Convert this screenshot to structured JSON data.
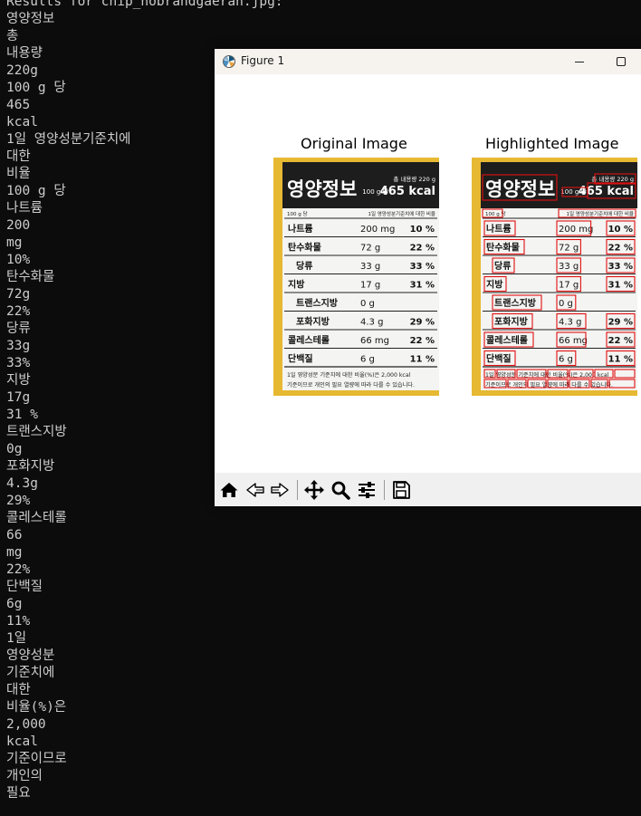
{
  "terminal": {
    "lines": [
      "Results for chip_nobrandgaeran.jpg:",
      "영양정보",
      "총",
      "내용량",
      "220g",
      "100 g 당",
      "465",
      "kcal",
      "1일 영양성분기준치에",
      "대한",
      "비율",
      "100 g 당",
      "나트륨",
      "200",
      "mg",
      "10%",
      "탄수화물",
      "72g",
      "22%",
      "당류",
      "33g",
      "33%",
      "지방",
      "17g",
      "31 %",
      "트랜스지방",
      "0g",
      "포화지방",
      "4.3g",
      "29%",
      "콜레스테롤",
      "66",
      "mg",
      "22%",
      "단백질",
      "6g",
      "11%",
      "1일",
      "영양성분",
      "기준치에",
      "대한",
      "비율(%)은",
      "2,000",
      "kcal",
      "기준이므로",
      "개인의",
      "필요"
    ]
  },
  "window": {
    "title": "Figure 1",
    "minimize_icon": "minimize-icon",
    "maximize_icon": "maximize-icon"
  },
  "figure": {
    "left_title": "Original Image",
    "right_title": "Highlighted Image",
    "box_color": "#e01010"
  },
  "label": {
    "header": "영양정보",
    "total": "총 내용량 220 g",
    "per": "100 g 당",
    "kcal": "465 kcal",
    "col_header_left": "100 g 당",
    "col_header_right": "1일 영양성분기준치에 대한 비율",
    "rows": [
      {
        "name": "나트륨",
        "amount": "200 mg",
        "pct": "10 %",
        "indent": 0
      },
      {
        "name": "탄수화물",
        "amount": "72 g",
        "pct": "22 %",
        "indent": 0
      },
      {
        "name": "당류",
        "amount": "33 g",
        "pct": "33 %",
        "indent": 1
      },
      {
        "name": "지방",
        "amount": "17 g",
        "pct": "31 %",
        "indent": 0
      },
      {
        "name": "트랜스지방",
        "amount": "0 g",
        "pct": "",
        "indent": 1
      },
      {
        "name": "포화지방",
        "amount": "4.3 g",
        "pct": "29 %",
        "indent": 1
      },
      {
        "name": "콜레스테롤",
        "amount": "66 mg",
        "pct": "22 %",
        "indent": 0
      },
      {
        "name": "단백질",
        "amount": "6 g",
        "pct": "11 %",
        "indent": 0
      }
    ],
    "footer1": "1일 영양성분 기준치에 대한 비율(%)은 2,000 kcal",
    "footer2": "기준이므로 개인의 필요 열량에 따라 다를 수 있습니다."
  },
  "toolbar": {
    "items": [
      "home-icon",
      "back-icon",
      "forward-icon",
      "pan-icon",
      "zoom-icon",
      "configure-subplots-icon",
      "save-icon"
    ]
  }
}
